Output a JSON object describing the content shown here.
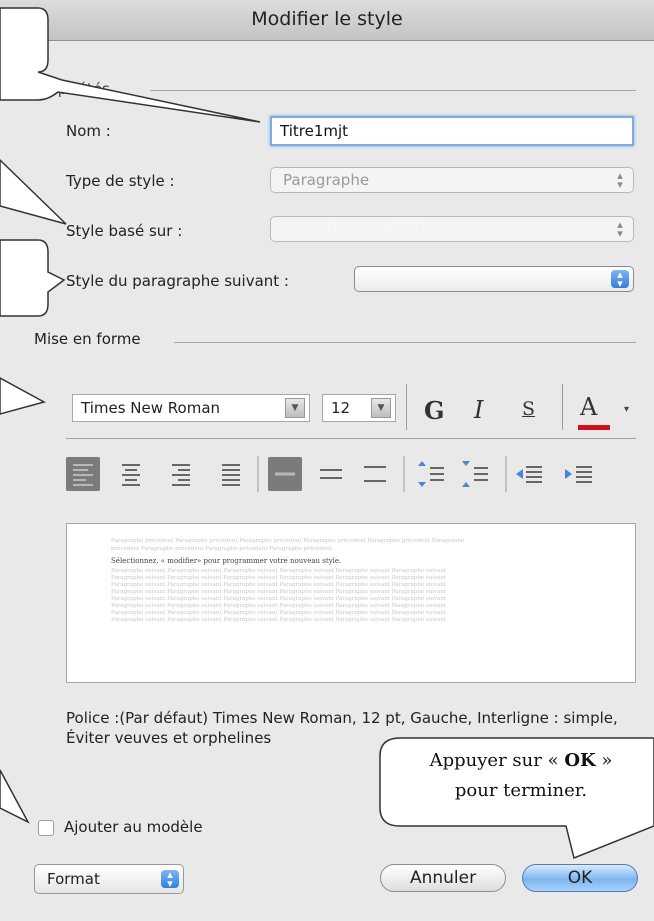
{
  "window": {
    "title": "Modifier le style"
  },
  "properties": {
    "section_label": "Propriétés",
    "name_label": "Nom :",
    "name_value": "Titre1mjt",
    "type_label": "Type de style :",
    "type_value": "Paragraphe",
    "based_on_label": "Style basé sur :",
    "based_on_value": "(aucun style)",
    "next_label": "Style du paragraphe suivant :",
    "next_value": ""
  },
  "formatting": {
    "section_label": "Mise en forme",
    "font_name": "Times New Roman",
    "font_size": "12",
    "bold_label": "G",
    "italic_label": "I",
    "underline_label": "S",
    "color_label": "A",
    "text_color": "#d0101a"
  },
  "preview": {
    "prev_line1": "Paragraphe précédent Paragraphe précédent Paragraphe précédent Paragraphe précédent Paragraphe précédent Paragraphe",
    "prev_line2": "précédent Paragraphe précédent Paragraphe précédent Paragraphe précédent",
    "main_text": "Sélectionnez, « modifier» pour programmer votre nouveau style.",
    "next_line": "Paragraphe suivant Paragraphe suivant Paragraphe suivant Paragraphe suivant Paragraphe suivant Paragraphe suivant"
  },
  "description": "Police :(Par défaut) Times New Roman, 12 pt, Gauche, Interligne : simple, Éviter veuves et orphelines",
  "add_to_template_label": "Ajouter au modèle",
  "buttons": {
    "format": "Format",
    "cancel": "Annuler",
    "ok": "OK"
  },
  "callout": {
    "line1_prefix": "Appuyer sur « ",
    "line1_bold": "OK",
    "line1_suffix": " »",
    "line2": "pour terminer."
  },
  "colors": {
    "accent": "#2f7fe0",
    "focus_ring": "#7aaee3"
  },
  "icons": [
    "align-left-icon",
    "align-center-icon",
    "align-right-icon",
    "justify-icon",
    "single-spacing-icon",
    "one-half-spacing-icon",
    "double-spacing-icon",
    "increase-space-before-icon",
    "decrease-space-before-icon",
    "decrease-indent-icon",
    "increase-indent-icon"
  ]
}
